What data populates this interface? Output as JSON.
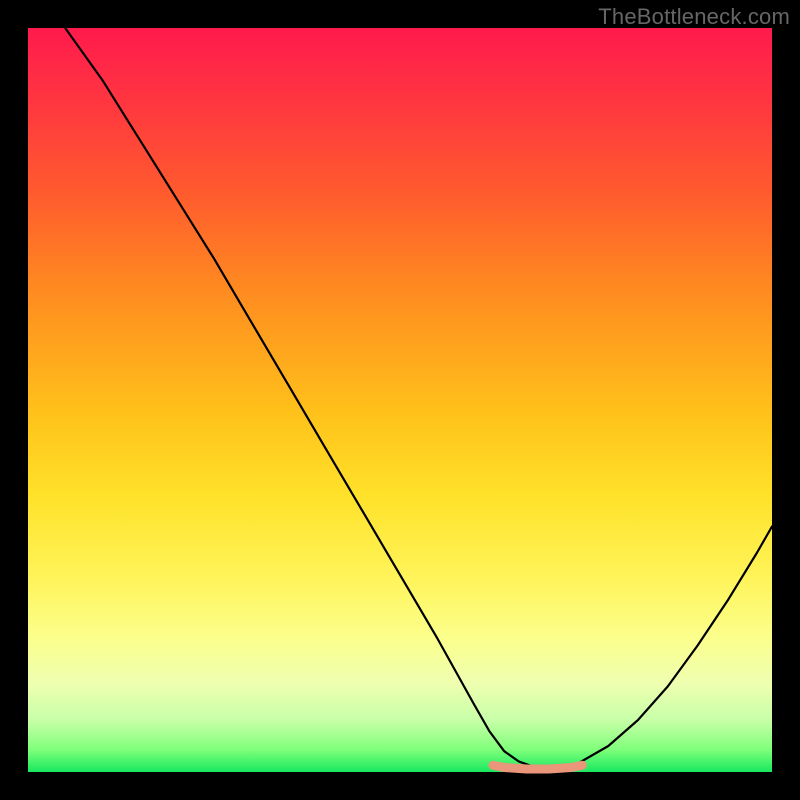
{
  "watermark": {
    "text": "TheBottleneck.com"
  },
  "chart_data": {
    "type": "line",
    "title": "",
    "xlabel": "",
    "ylabel": "",
    "xlim": [
      0,
      100
    ],
    "ylim": [
      0,
      100
    ],
    "grid": false,
    "legend": false,
    "background_gradient": [
      "#ff1a4d",
      "#fff45a",
      "#18e860"
    ],
    "series": [
      {
        "name": "bottleneck-curve",
        "color": "#000000",
        "x": [
          5,
          10,
          15,
          20,
          25,
          30,
          35,
          40,
          45,
          50,
          55,
          60,
          62,
          64,
          66,
          68,
          70,
          72,
          74,
          78,
          82,
          86,
          90,
          94,
          98,
          100
        ],
        "y_pct": [
          100,
          93,
          85,
          77,
          69,
          60.5,
          52,
          43.5,
          35,
          26.5,
          18,
          9,
          5.5,
          2.8,
          1.4,
          0.7,
          0.5,
          0.6,
          1.2,
          3.5,
          7,
          11.5,
          17,
          23,
          29.5,
          33
        ]
      },
      {
        "name": "optimal-flat-segment",
        "color": "#e9967a",
        "x": [
          62.5,
          64,
          65.5,
          67,
          68.5,
          70,
          71.5,
          73,
          74.5
        ],
        "y_pct": [
          0.9,
          0.6,
          0.5,
          0.4,
          0.4,
          0.4,
          0.5,
          0.6,
          0.9
        ]
      }
    ],
    "annotations": []
  }
}
